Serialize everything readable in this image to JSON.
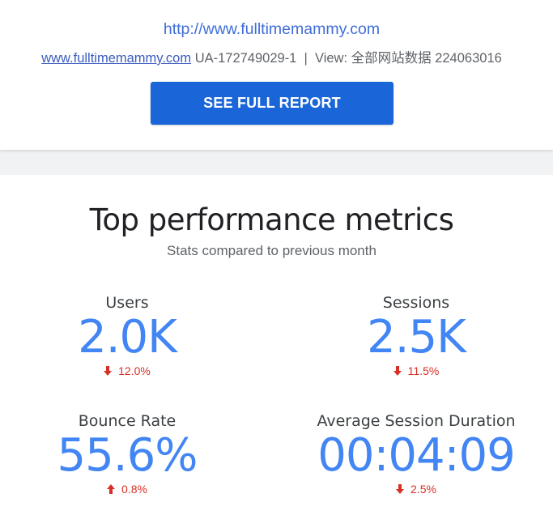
{
  "header": {
    "site_url": "http://www.fulltimemammy.com",
    "domain_link": "www.fulltimemammy.com",
    "account_info": "UA-172749029-1  |  View: 全部网站数据 224063016",
    "cta_label": "SEE FULL REPORT"
  },
  "metrics_section": {
    "title": "Top performance metrics",
    "subtitle": "Stats compared to previous month",
    "metrics": [
      {
        "label": "Users",
        "value": "2.0K",
        "change": "12.0%",
        "direction": "down"
      },
      {
        "label": "Sessions",
        "value": "2.5K",
        "change": "11.5%",
        "direction": "down"
      },
      {
        "label": "Bounce Rate",
        "value": "55.6%",
        "change": "0.8%",
        "direction": "up"
      },
      {
        "label": "Average Session Duration",
        "value": "00:04:09",
        "change": "2.5%",
        "direction": "down"
      }
    ]
  },
  "colors": {
    "accent_blue": "#4285f4",
    "button_blue": "#1a66d8",
    "link_blue": "#3f6ed8",
    "negative_red": "#d93025",
    "band_gray": "#f1f2f4"
  },
  "icons": {
    "down": "arrow-down-icon",
    "up": "arrow-up-icon"
  }
}
